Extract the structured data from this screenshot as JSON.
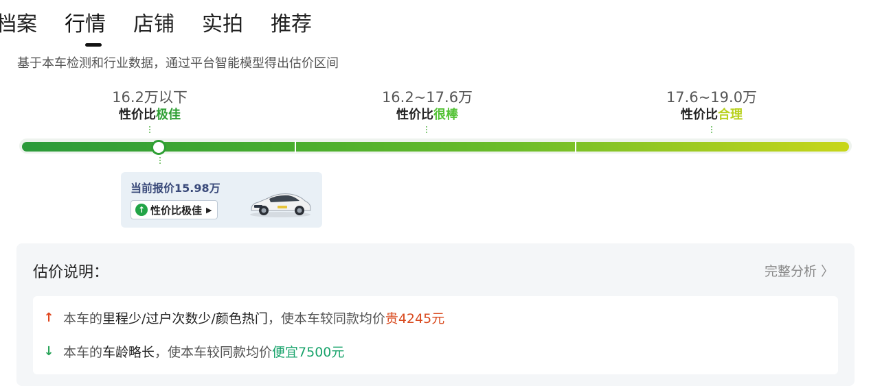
{
  "tabs": [
    {
      "label": "档案"
    },
    {
      "label": "行情"
    },
    {
      "label": "店铺"
    },
    {
      "label": "实拍"
    },
    {
      "label": "推荐"
    }
  ],
  "subtitle": "基于本车检测和行业数据，通过平台智能模型得出估价区间",
  "tiers": [
    {
      "price": "16.2万以下",
      "label_prefix": "性价比",
      "label_highlight": "极佳",
      "color": "#2e9f34"
    },
    {
      "price": "16.2~17.6万",
      "label_prefix": "性价比",
      "label_highlight": "很棒",
      "color": "#52c234"
    },
    {
      "price": "17.6~19.0万",
      "label_prefix": "性价比",
      "label_highlight": "合理",
      "color": "#b8d11e"
    }
  ],
  "current": {
    "label": "当前报价15.98万",
    "tag_icon": "arrow-up-circle-icon",
    "tag": "性价比极佳",
    "tag_arrow": "▶",
    "level_fraction": 0.16
  },
  "explanation": {
    "title": "估价说明：",
    "link": "完整分析 〉",
    "reasons": [
      {
        "direction": "up",
        "icon": "arrow-up-icon",
        "glyph": "↑",
        "prefix": "本车的",
        "emphasis": "里程少/过户次数少/颜色热门",
        "middle": "，使本车较同款均价",
        "value": "贵4245元",
        "color": "#d94a1e"
      },
      {
        "direction": "down",
        "icon": "arrow-down-icon",
        "glyph": "↓",
        "prefix": "本车的",
        "emphasis": "车龄略长",
        "middle": "，使本车较同款均价",
        "value": "便宜7500元",
        "color": "#18a36b"
      }
    ]
  }
}
